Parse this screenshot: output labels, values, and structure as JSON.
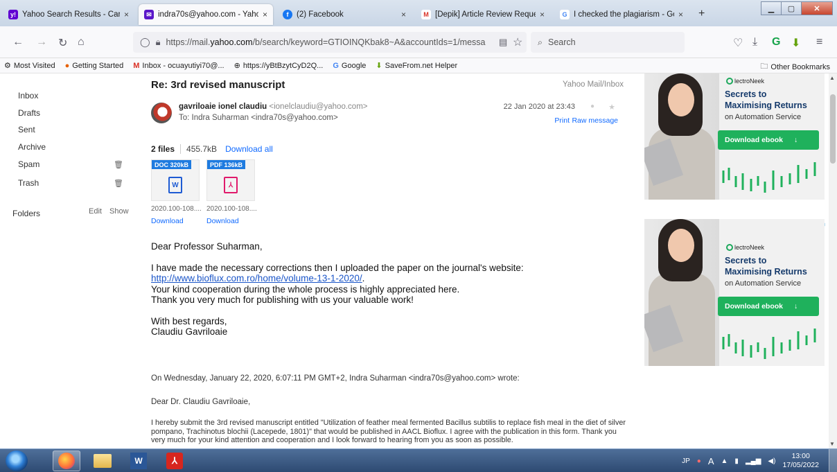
{
  "tabs": [
    {
      "title": "Yahoo Search Results - Cari Web",
      "close": "×",
      "icon": "yahoo-icon"
    },
    {
      "title": "indra70s@yahoo.com - Yahoo M",
      "close": "×",
      "icon": "yahoo-mail-icon"
    },
    {
      "title": "(2) Facebook",
      "close": "×",
      "icon": "facebook-icon"
    },
    {
      "title": "[Depik] Article Review Request",
      "close": "×",
      "icon": "gmail-icon"
    },
    {
      "title": "I checked the plagiarism - Goog",
      "close": "×",
      "icon": "google-icon"
    }
  ],
  "new_tab": "+",
  "url": {
    "prefix": "https://mail.",
    "domain": "yahoo.com",
    "rest": "/b/search/keyword=GTIOINQKbak8~A&accountIds=1/messa"
  },
  "search": {
    "placeholder": "Search"
  },
  "bookmarks": [
    {
      "label": "Most Visited",
      "icon": "gear-icon"
    },
    {
      "label": "Getting Started",
      "icon": "firefox-icon"
    },
    {
      "label": "Inbox - ocuayutiyi70@...",
      "icon": "gmail-icon"
    },
    {
      "label": "https://yBtBzytCyD2Q...",
      "icon": "globe-icon"
    },
    {
      "label": "Google",
      "icon": "google-icon"
    },
    {
      "label": "SaveFrom.net Helper",
      "icon": "download-icon"
    }
  ],
  "other_bookmarks": "Other Bookmarks",
  "sidebar": {
    "items": [
      "Inbox",
      "Drafts",
      "Sent",
      "Archive",
      "Spam",
      "Trash"
    ],
    "folders": "Folders",
    "edit": "Edit",
    "show": "Show"
  },
  "message": {
    "subject": "Re: 3rd revised manuscript",
    "folder_path": "Yahoo Mail/Inbox",
    "from_name": "gavriloaie ionel claudiu",
    "from_email": "<ionelclaudiu@yahoo.com>",
    "to": "To: Indra Suharman <indra70s@yahoo.com>",
    "date": "22 Jan 2020 at 23:43",
    "print": "Print",
    "raw": "Raw message",
    "files_count": "2 files",
    "files_size": "455.7kB",
    "download_all": "Download all",
    "attachments": [
      {
        "badge": "DOC   320kB",
        "name": "2020.100-108....",
        "download": "Download",
        "color": "#1e5bd3",
        "icon": "word-doc-icon"
      },
      {
        "badge": "PDF   136kB",
        "name": "2020.100-108....",
        "download": "Download",
        "color": "#e0196b",
        "icon": "pdf-icon"
      }
    ],
    "greeting": "Dear Professor Suharman,",
    "line1": "I have made the necessary corrections then I uploaded the paper on the journal's website:",
    "link": "http://www.bioflux.com.ro/home/volume-13-1-2020/",
    "link_suffix": ".",
    "line2": "Your kind cooperation during the whole process is highly appreciated here.",
    "line3": "Thank you very much for publishing with us your valuable work!",
    "closing": "With best regards,",
    "signature": "Claudiu Gavriloaie",
    "quote_header": "On Wednesday, January 22, 2020, 6:07:11 PM GMT+2, Indra Suharman <indra70s@yahoo.com> wrote:",
    "quote_greeting": "Dear Dr. Claudiu Gavriloaie,",
    "quote_body": "I hereby submit the 3rd revised manuscript entitled \"Utilization of feather meal fermented Bacillus subtilis to replace fish meal in the diet of silver pompano, Trachinotus blochii (Lacepede, 1801)\" that would be published in AACL Bioflux. I agree with the publication in this form. Thank you very much for your kind attention and cooperation and I look forward to hearing from you as soon as possible."
  },
  "ads": [
    {
      "brand": "lectroNeek",
      "headline_1": "Secrets to",
      "headline_2": "Maximising Returns",
      "sub": "on Automation Service",
      "cta": "Download ebook",
      "cta_icon": "↓"
    },
    {
      "brand": "lectroNeek",
      "headline_1": "Secrets to",
      "headline_2": "Maximising Returns",
      "sub": "on Automation Service",
      "cta": "Download ebook",
      "cta_icon": "↓"
    }
  ],
  "taskbar": {
    "lang": "JP",
    "ime": "A",
    "time": "13:00",
    "date": "17/05/2022"
  },
  "colors": {
    "accent_link": "#0f69ff",
    "ad_green": "#1fb15c",
    "ad_title": "#153a6b"
  }
}
